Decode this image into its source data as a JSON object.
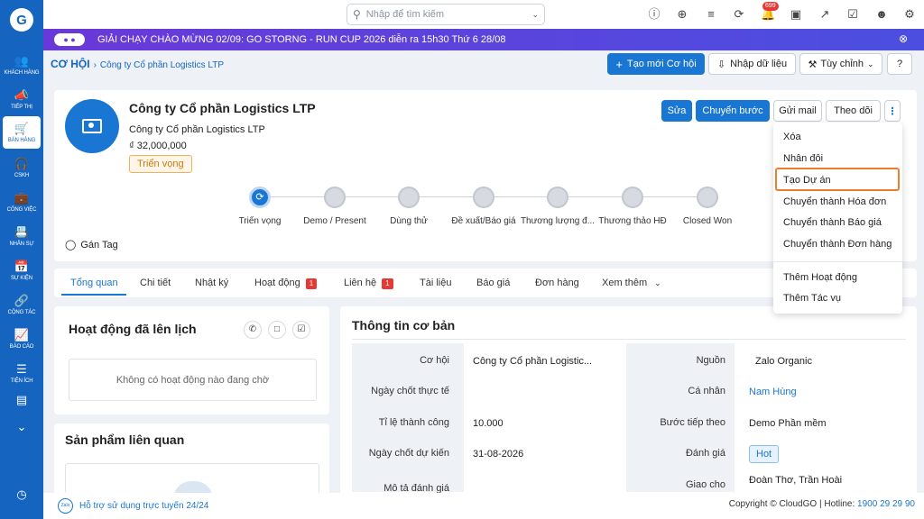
{
  "sidebar": {
    "logo": "G",
    "items": [
      {
        "label": "KHÁCH HÀNG",
        "icon": "users-icon"
      },
      {
        "label": "TIẾP THỊ",
        "icon": "megaphone-icon"
      },
      {
        "label": "BÁN HÀNG",
        "icon": "cart-icon",
        "active": true
      },
      {
        "label": "CSKH",
        "icon": "headset-icon"
      },
      {
        "label": "CÔNG VIỆC",
        "icon": "briefcase-icon"
      },
      {
        "label": "NHÂN SỰ",
        "icon": "id-card-icon"
      },
      {
        "label": "SỰ KIỆN",
        "icon": "calendar-icon"
      },
      {
        "label": "CỘNG TÁC",
        "icon": "network-icon"
      },
      {
        "label": "BÁO CÁO",
        "icon": "report-icon"
      },
      {
        "label": "TIỆN ÍCH",
        "icon": "layers-icon"
      }
    ]
  },
  "topbar": {
    "search_placeholder": "Nhập để tìm kiếm",
    "notification_count": "699"
  },
  "banner": {
    "text": "GIẢI CHẠY CHÀO MỪNG 02/09: GO STORNG - RUN CUP 2026 diễn ra 15h30 Thứ 6 28/08"
  },
  "breadcrumb": {
    "module": "CƠ HỘI",
    "record": "Công ty Cổ phần Logistics LTP"
  },
  "header_actions": {
    "create": "Tạo mới Cơ hội",
    "import": "Nhập dữ liệu",
    "customize": "Tùy chỉnh"
  },
  "record": {
    "title": "Công ty Cổ phần Logistics LTP",
    "company": "Công ty Cổ phần Logistics LTP",
    "amount": "₫ 32,000,000",
    "status": "Triển vọng",
    "tag_label": "Gán Tag"
  },
  "record_actions": {
    "edit": "Sửa",
    "change_stage": "Chuyển bước",
    "send_mail": "Gửi mail",
    "follow": "Theo dõi"
  },
  "stages": [
    "Triển vọng",
    "Demo / Present",
    "Dùng thử",
    "Đề xuất/Báo giá",
    "Thương lượng đ...",
    "Thương thảo HĐ",
    "Closed Won"
  ],
  "tabs": [
    {
      "label": "Tổng quan",
      "active": true
    },
    {
      "label": "Chi tiết"
    },
    {
      "label": "Nhật ký"
    },
    {
      "label": "Hoạt động",
      "badge": "1"
    },
    {
      "label": "Liên hệ",
      "badge": "1"
    },
    {
      "label": "Tài liệu"
    },
    {
      "label": "Báo giá"
    },
    {
      "label": "Đơn hàng"
    },
    {
      "label": "Xem thêm"
    }
  ],
  "scheduled": {
    "title": "Hoạt động đã lên lịch",
    "empty": "Không có hoạt động nào đang chờ"
  },
  "products": {
    "title": "Sản phẩm liên quan"
  },
  "basic_info": {
    "title": "Thông tin cơ bản",
    "left": [
      {
        "label": "Cơ hội",
        "value": "Công ty Cổ phần Logistic..."
      },
      {
        "label": "Ngày chốt thực tế",
        "value": ""
      },
      {
        "label": "Tỉ lệ thành công",
        "value": "10.000"
      },
      {
        "label": "Ngày chốt dự kiến",
        "value": "31-08-2026"
      },
      {
        "label": "Mô tả đánh giá",
        "value": ""
      }
    ],
    "right": [
      {
        "label": "Nguồn",
        "value": "Zalo Organic"
      },
      {
        "label": "Cá nhân",
        "value": "Nam Hùng"
      },
      {
        "label": "Bước tiếp theo",
        "value": "Demo Phần mềm"
      },
      {
        "label": "Đánh giá",
        "value": "Hot"
      },
      {
        "label": "Giao cho",
        "value": "Đoàn Thơ, Trần Hoài"
      }
    ]
  },
  "dropdown_menu": {
    "items": [
      "Xóa",
      "Nhân đôi",
      "Tạo Dự án",
      "Chuyển thành Hóa đơn",
      "Chuyển thành Báo giá",
      "Chuyển thành Đơn hàng"
    ],
    "items2": [
      "Thêm Hoạt động",
      "Thêm Tác vụ"
    ],
    "highlighted": "Tạo Dự án"
  },
  "footer": {
    "support": "Hỗ trợ sử dụng trực tuyến 24/24",
    "copyright": "Copyright © CloudGO",
    "hotline_label": "| Hotline:",
    "hotline": "1900 29 29 90"
  },
  "colors": {
    "brand": "#1565c0",
    "primary_button": "#1976d2",
    "highlight_border": "#ef7d2f",
    "banner": "#6a38d8"
  }
}
